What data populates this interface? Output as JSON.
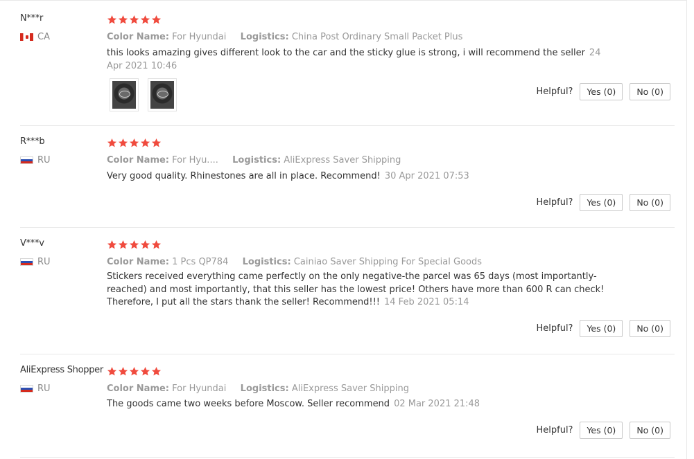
{
  "reviews": [
    {
      "user": "N***r",
      "country": "CA",
      "flag": "canada-flag-icon",
      "rating": 5,
      "color_label": "Color Name:",
      "color_value": "For Hyundai",
      "logistics_label": "Logistics:",
      "logistics_value": "China Post Ordinary Small Packet Plus",
      "text": "this looks amazing gives different look to the car and the sticky glue is strong, i will recommend the seller",
      "date": "24 Apr 2021 10:46",
      "has_photos": true,
      "helpful_label": "Helpful?",
      "yes_label": "Yes (0)",
      "no_label": "No (0)"
    },
    {
      "user": "R***b",
      "country": "RU",
      "flag": "russia-flag-icon",
      "rating": 5,
      "color_label": "Color Name:",
      "color_value": "For Hyu....",
      "logistics_label": "Logistics:",
      "logistics_value": "AliExpress Saver Shipping",
      "text": "Very good quality. Rhinestones are all in place. Recommend!",
      "date": "30 Apr 2021 07:53",
      "has_photos": false,
      "helpful_label": "Helpful?",
      "yes_label": "Yes (0)",
      "no_label": "No (0)"
    },
    {
      "user": "V***v",
      "country": "RU",
      "flag": "russia-flag-icon",
      "rating": 5,
      "color_label": "Color Name:",
      "color_value": "1 Pcs QP784",
      "logistics_label": "Logistics:",
      "logistics_value": "Cainiao Saver Shipping For Special Goods",
      "text": "Stickers received everything came perfectly on the only negative-the parcel was 65 days (most importantly-reached) and most importantly, that this seller has the lowest price! Others have more than 600 R can check! Therefore, I put all the stars thank the seller! Recommend!!!",
      "date": "14 Feb 2021 05:14",
      "has_photos": false,
      "helpful_label": "Helpful?",
      "yes_label": "Yes (0)",
      "no_label": "No (0)"
    },
    {
      "user": "AliExpress Shopper",
      "country": "RU",
      "flag": "russia-flag-icon",
      "rating": 5,
      "color_label": "Color Name:",
      "color_value": "For Hyundai",
      "logistics_label": "Logistics:",
      "logistics_value": "AliExpress Saver Shipping",
      "text": "The goods came two weeks before Moscow. Seller recommend",
      "date": "02 Mar 2021 21:48",
      "has_photos": false,
      "helpful_label": "Helpful?",
      "yes_label": "Yes (0)",
      "no_label": "No (0)"
    }
  ],
  "colors": {
    "star": "#f04b3e",
    "muted_text": "#999999",
    "body_text": "#333333",
    "divider": "#e8e8e8"
  }
}
